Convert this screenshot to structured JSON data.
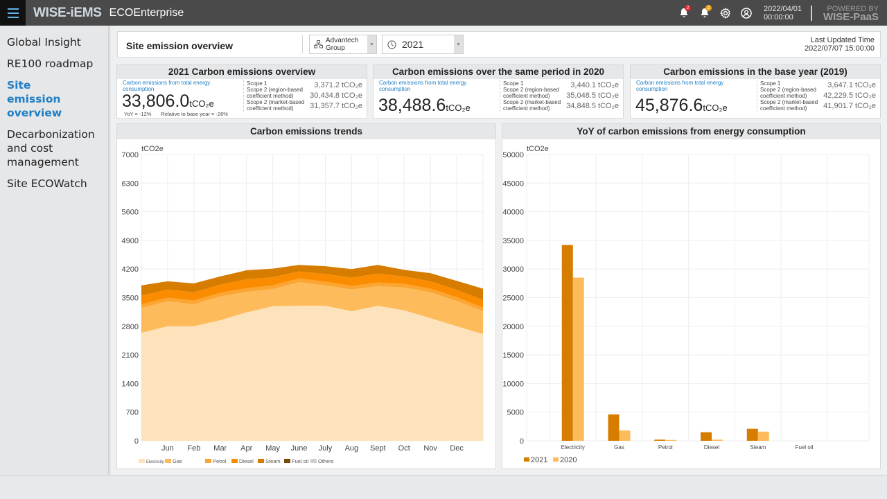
{
  "topbar": {
    "brand": "WISE-iEMS",
    "product": "ECOEnterprise",
    "alarm_badge_red": "2",
    "alarm_badge_yellow": "2",
    "date": "2022/04/01",
    "time": "00:00:00",
    "powered_by": "POWERED BY",
    "powered_brand": "WISE-PaaS",
    "colors": {
      "bar": "#4a4a4a",
      "badge_red": "#e0252b",
      "badge_yellow": "#e8a317",
      "menu_accent": "#5fb3e6"
    }
  },
  "sidebar": {
    "items": [
      {
        "label": "Global Insight",
        "active": false
      },
      {
        "label": "RE100 roadmap",
        "active": false
      },
      {
        "label": "Site emission overview",
        "active": true
      },
      {
        "label": "Decarbonization and cost management",
        "active": false
      },
      {
        "label": "Site ECOWatch",
        "active": false
      }
    ]
  },
  "header": {
    "title": "Site emission overview",
    "org_select": "Advantech Group",
    "year_select": "2021",
    "last_updated_label": "Last Updated Time",
    "last_updated_value": "2022/07/07 15:00:00"
  },
  "cards": [
    {
      "title": "2021  Carbon emissions overview",
      "label": "Carbon emissions from total energy consumption",
      "value": "33,806.0",
      "unit": "tCO₂e",
      "yoy": "YoY = -12%",
      "relative": "Relative to base year = -26%",
      "scope_names": [
        "Scope 1",
        "Scope 2 (region-based",
        "coefficient method)",
        "Scope 2 (market-based",
        "coefficient method)"
      ],
      "scope_values": [
        "3,371.2 tCO₂e",
        "30,434.8 tCO₂e",
        "31,357.7 tCO₂e"
      ]
    },
    {
      "title": "Carbon emissions over the same period in 2020",
      "label": "Carbon emissions from total energy consumption",
      "value": "38,488.6",
      "unit": "tCO₂e",
      "scope_names": [
        "Scope 1",
        "Scope 2 (region-based",
        "coefficient method)",
        "Scope 2 (market-based",
        "coefficient method)"
      ],
      "scope_values": [
        "3,440.1 tCO₂e",
        "35,048.5 tCO₂e",
        "34,848.5 tCO₂e"
      ]
    },
    {
      "title": "Carbon emissions in the base year (2019)",
      "label": "Carbon emissions from total energy consumption",
      "value": "45,876.6",
      "unit": "tCO₂e",
      "scope_names": [
        "Scope 1",
        "Scope 2 (region-based",
        "coefficient method)",
        "Scope 2 (market-based",
        "coefficient method)"
      ],
      "scope_values": [
        "3,647.1 tCO₂e",
        "42,229.5 tCO₂e",
        "41,901.7 tCO₂e"
      ]
    }
  ],
  "chart_data": [
    {
      "type": "area",
      "stacked": true,
      "title": "Carbon emissions trends",
      "ylabel": "tCO2e",
      "ylim": [
        0,
        7000
      ],
      "yticks": [
        0,
        700,
        1400,
        2100,
        2800,
        3500,
        4200,
        4900,
        5600,
        6300,
        7000
      ],
      "categories": [
        "Jun",
        "Feb",
        "Mar",
        "Apr",
        "May",
        "June",
        "July",
        "Aug",
        "Sept",
        "Oct",
        "Nov",
        "Dec"
      ],
      "grid": true,
      "legend_position": "bottom-left",
      "series": [
        {
          "name": "Electricity",
          "color": "#fde3bb",
          "values": [
            2640,
            2800,
            2800,
            2950,
            3140,
            3290,
            3300,
            3300,
            3170,
            3300,
            3190,
            3000,
            2800,
            2610
          ]
        },
        {
          "name": "Gas",
          "color": "#fdbb5c",
          "values": [
            610,
            610,
            540,
            580,
            500,
            420,
            580,
            500,
            530,
            480,
            560,
            630,
            620,
            560
          ]
        },
        {
          "name": "Petrol",
          "color": "#fca530",
          "values": [
            90,
            90,
            90,
            90,
            90,
            90,
            90,
            90,
            90,
            90,
            90,
            90,
            90,
            90
          ]
        },
        {
          "name": "Diesel",
          "color": "#fb8c00",
          "values": [
            210,
            200,
            200,
            200,
            220,
            200,
            170,
            190,
            200,
            220,
            180,
            180,
            180,
            190
          ]
        },
        {
          "name": "Steam",
          "color": "#d67d00",
          "values": [
            250,
            200,
            220,
            200,
            220,
            210,
            160,
            190,
            210,
            210,
            160,
            200,
            220,
            270
          ]
        },
        {
          "name": "Fuel oil",
          "color": "#7a4a0a",
          "values": [
            0,
            0,
            0,
            0,
            0,
            0,
            0,
            0,
            0,
            0,
            0,
            0,
            0,
            0
          ]
        },
        {
          "name": "Others",
          "color": "#cfcfcf",
          "values": [
            0,
            0,
            0,
            0,
            0,
            0,
            0,
            0,
            0,
            0,
            0,
            0,
            0,
            0
          ]
        }
      ]
    },
    {
      "type": "bar",
      "title": "YoY of carbon emissions from energy consumption",
      "ylabel": "tCO2e",
      "ylim": [
        0,
        50000
      ],
      "yticks": [
        0,
        5000,
        10000,
        15000,
        20000,
        25000,
        30000,
        35000,
        40000,
        45000,
        50000
      ],
      "categories": [
        "Electricity",
        "Gas",
        "Petrol",
        "Diesel",
        "Steam",
        "Fuel oil"
      ],
      "grid": true,
      "legend_position": "bottom-left",
      "series": [
        {
          "name": "2021",
          "color": "#d67d00",
          "values": [
            34200,
            4600,
            200,
            1500,
            2100,
            0
          ]
        },
        {
          "name": "2020",
          "color": "#fdbb5c",
          "values": [
            28500,
            1800,
            150,
            200,
            1600,
            0
          ]
        }
      ]
    }
  ]
}
